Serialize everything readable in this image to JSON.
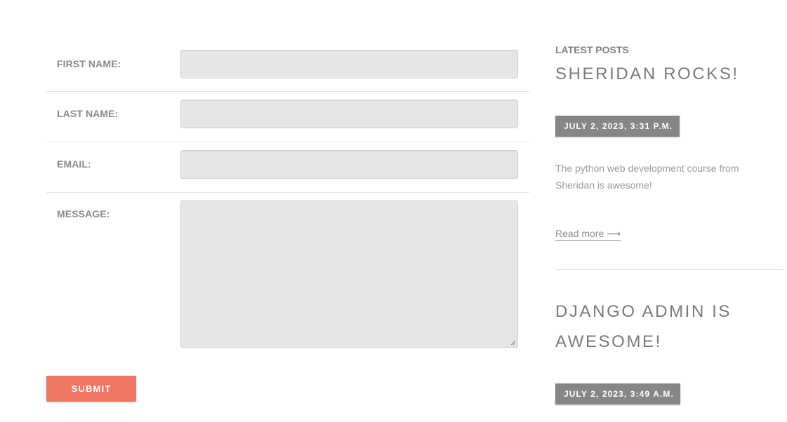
{
  "form": {
    "fields": [
      {
        "label": "FIRST NAME:",
        "value": ""
      },
      {
        "label": "LAST NAME:",
        "value": ""
      },
      {
        "label": "EMAIL:",
        "value": ""
      },
      {
        "label": "MESSAGE:",
        "value": ""
      }
    ],
    "submit_label": "SUBMIT"
  },
  "sidebar": {
    "heading": "LATEST POSTS",
    "posts": [
      {
        "title": "SHERIDAN ROCKS!",
        "date": "JULY 2, 2023, 3:31 P.M.",
        "excerpt": "The python web development course from Sheridan is awesome!",
        "read_more": "Read more ⟶"
      },
      {
        "title": "DJANGO ADMIN IS AWESOME!",
        "date": "JULY 2, 2023, 3:49 A.M."
      }
    ]
  },
  "colors": {
    "submit_button": "#ef7564",
    "date_badge": "#868686",
    "input_background": "#e6e6e6",
    "text": "#8a8a8a"
  }
}
